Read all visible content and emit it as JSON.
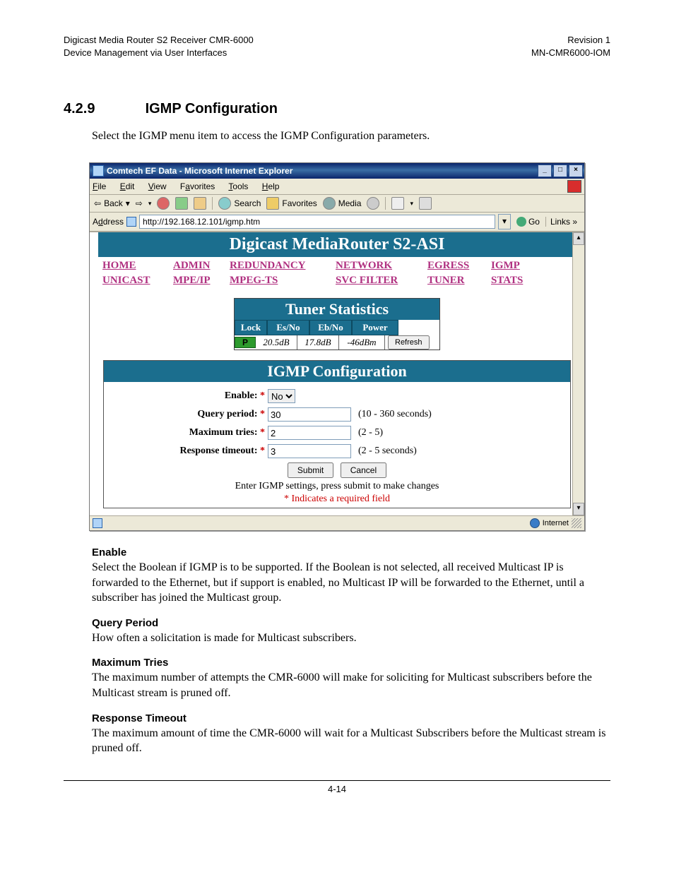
{
  "header": {
    "left1": "Digicast Media Router S2 Receiver CMR-6000",
    "left2": "Device Management via User Interfaces",
    "right1": "Revision 1",
    "right2": "MN-CMR6000-IOM"
  },
  "section": {
    "number": "4.2.9",
    "title": "IGMP Configuration"
  },
  "intro": "Select the IGMP menu item to access the IGMP Configuration parameters.",
  "browser": {
    "title": "Comtech EF Data - Microsoft Internet Explorer",
    "menus": {
      "file": "File",
      "edit": "Edit",
      "view": "View",
      "favorites": "Favorites",
      "tools": "Tools",
      "help": "Help"
    },
    "toolbar": {
      "back": "Back",
      "search": "Search",
      "favorites": "Favorites",
      "media": "Media"
    },
    "address_label": "Address",
    "address_value": "http://192.168.12.101/igmp.htm",
    "go": "Go",
    "links": "Links",
    "status_zone": "Internet"
  },
  "webpage": {
    "banner": "Digicast MediaRouter S2-ASI",
    "nav": {
      "r1": [
        "HOME",
        "ADMIN",
        "REDUNDANCY",
        "NETWORK",
        "EGRESS",
        "IGMP"
      ],
      "r2": [
        "UNICAST",
        "MPE/IP",
        "MPEG-TS",
        "SVC FILTER",
        "TUNER",
        "STATS"
      ]
    },
    "tuner": {
      "title": "Tuner Statistics",
      "headers": [
        "Lock",
        "Es/No",
        "Eb/No",
        "Power"
      ],
      "lock": "P",
      "esno": "20.5dB",
      "ebno": "17.8dB",
      "power": "-46dBm",
      "refresh": "Refresh"
    },
    "igmp": {
      "title": "IGMP Configuration",
      "enable_label": "Enable:",
      "enable_value": "No",
      "query_label": "Query period:",
      "query_value": "30",
      "query_hint": "(10 - 360 seconds)",
      "tries_label": "Maximum tries:",
      "tries_value": "2",
      "tries_hint": "(2 - 5)",
      "timeout_label": "Response timeout:",
      "timeout_value": "3",
      "timeout_hint": "(2 - 5 seconds)",
      "submit": "Submit",
      "cancel": "Cancel",
      "note": "Enter IGMP settings, press submit to make changes",
      "required": "* Indicates a required field"
    }
  },
  "descriptions": {
    "enable_h": "Enable",
    "enable_p": "Select the Boolean if IGMP is to be supported.  If the Boolean is not selected, all received Multicast IP is forwarded to the Ethernet, but if support is enabled, no Multicast IP will be forwarded to the Ethernet, until a subscriber has joined the Multicast group.",
    "query_h": "Query Period",
    "query_p": "How often a solicitation is made for Multicast subscribers.",
    "tries_h": "Maximum Tries",
    "tries_p": "The maximum number of attempts the CMR-6000 will make for soliciting for Multicast subscribers before the Multicast stream is pruned off.",
    "timeout_h": "Response Timeout",
    "timeout_p": "The maximum amount of time the CMR-6000 will wait for a Multicast Subscribers before the Multicast stream is pruned off."
  },
  "page_number": "4-14"
}
